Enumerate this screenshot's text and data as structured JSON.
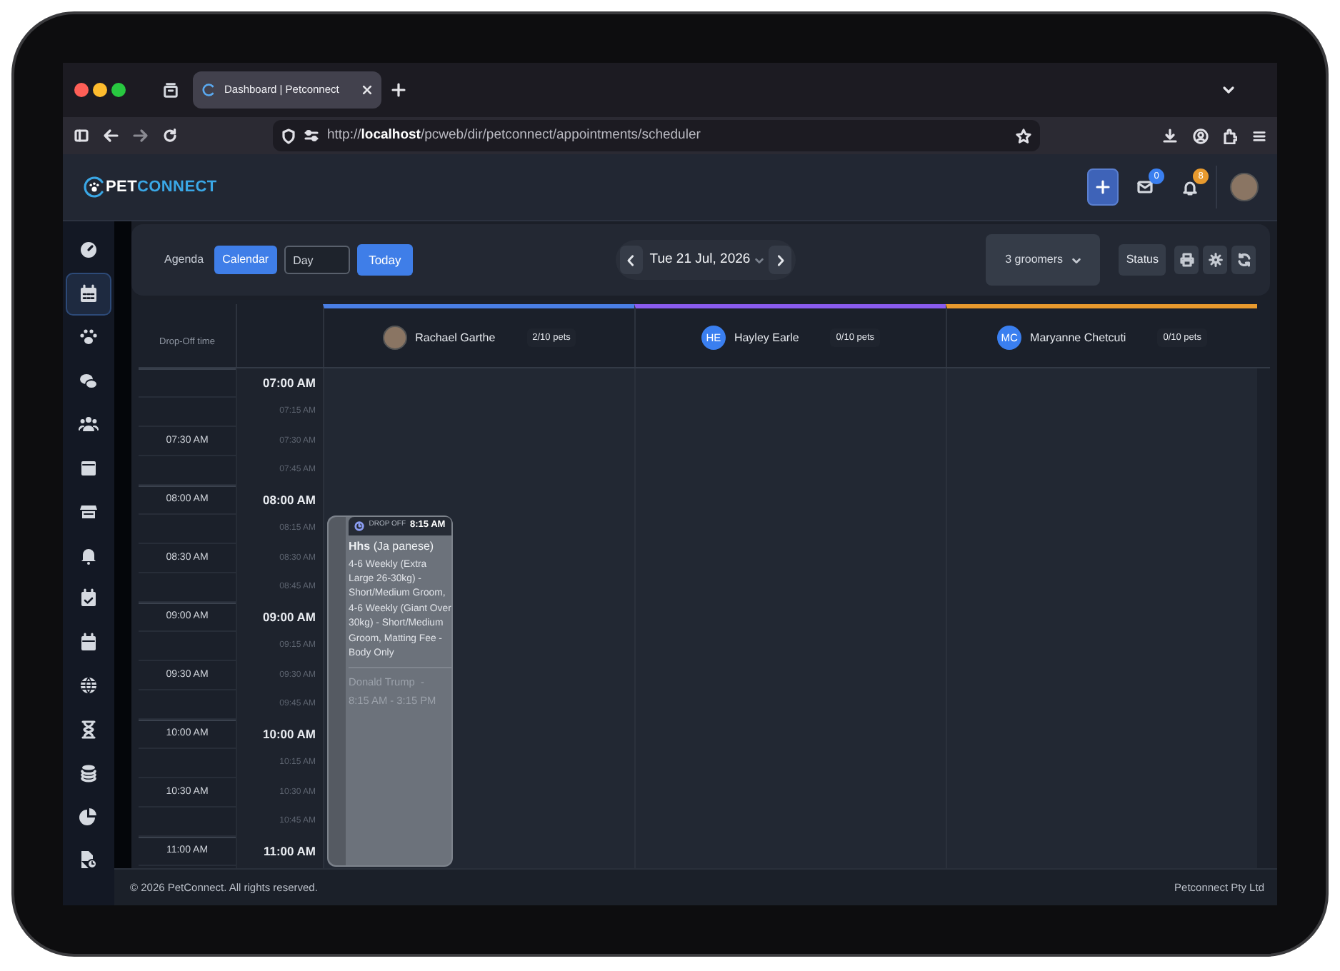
{
  "browser": {
    "tab": {
      "title": "Dashboard | Petconnect",
      "selected": true
    },
    "url": "http://**localhost**/pcweb/dir/petconnect/appointments/scheduler"
  },
  "header": {
    "logo": {
      "part_1": "PET",
      "part_2": "CONNECT"
    },
    "mail_badge": "0",
    "notification_badge": "8"
  },
  "sidebar": {
    "items": [
      {
        "selected": false
      },
      {
        "selected": true
      },
      {
        "selected": false
      },
      {
        "selected": false
      },
      {
        "selected": false
      },
      {
        "selected": false
      },
      {
        "selected": false
      },
      {
        "selected": false
      },
      {
        "selected": false
      },
      {
        "selected": false
      },
      {
        "selected": false
      },
      {
        "selected": false
      },
      {
        "selected": false
      },
      {
        "selected": false
      },
      {
        "selected": false
      }
    ]
  },
  "toolbar": {
    "views": [
      {
        "label": "Agenda",
        "selected": false
      },
      {
        "label": "Calendar",
        "selected": true
      }
    ],
    "range_select": {
      "value": "Day"
    },
    "today_button": "Today",
    "date": "Tue 21 Jul, 2026",
    "groomers_dropdown": "3 groomers",
    "status_button": "Status"
  },
  "scheduler": {
    "dropoff_heading": "Drop-Off time",
    "groomers": [
      {
        "name": "Rachael Garthe",
        "pets": "2/10 pets",
        "color": "#4a7fe6"
      },
      {
        "name": "Hayley Earle",
        "initials": "HE",
        "pets": "0/10 pets",
        "color": "#8a5cf0"
      },
      {
        "name": "Maryanne Chetcuti",
        "initials": "MC",
        "pets": "0/10 pets",
        "color": "#e89a2e"
      }
    ],
    "slots": [
      {
        "time": "07:00 AM",
        "major": true
      },
      {
        "time": "07:15 AM",
        "major": false
      },
      {
        "dropoff": "07:30 AM",
        "time": "07:30 AM",
        "major": false
      },
      {
        "time": "07:45 AM",
        "major": false
      },
      {
        "dropoff": "08:00 AM",
        "time": "08:00 AM",
        "major": true
      },
      {
        "time": "08:15 AM",
        "major": false,
        "appointments": [
          {
            "tag_label": "DROP OFF",
            "tag_time": "8:15 AM",
            "pet": "**Hhs** (Ja panese)",
            "services": "4-6 Weekly (Extra Large 26-30kg) - Short/Medium Groom, 4-6 Weekly (Giant Over 30kg) - Short/Medium Groom, Matting Fee - Body Only",
            "client": "Donald Trump  -",
            "time_range": "8:15 AM - 3:15 PM"
          }
        ]
      },
      {
        "dropoff": "08:30 AM",
        "time": "08:30 AM",
        "major": false
      },
      {
        "time": "08:45 AM",
        "major": false
      },
      {
        "dropoff": "09:00 AM",
        "time": "09:00 AM",
        "major": true
      },
      {
        "time": "09:15 AM",
        "major": false
      },
      {
        "dropoff": "09:30 AM",
        "time": "09:30 AM",
        "major": false
      },
      {
        "time": "09:45 AM",
        "major": false
      },
      {
        "dropoff": "10:00 AM",
        "time": "10:00 AM",
        "major": true
      },
      {
        "time": "10:15 AM",
        "major": false
      },
      {
        "dropoff": "10:30 AM",
        "time": "10:30 AM",
        "major": false
      },
      {
        "time": "10:45 AM",
        "major": false
      },
      {
        "dropoff": "11:00 AM",
        "time": "11:00 AM",
        "major": true
      }
    ]
  },
  "footer": {
    "copyright": "© 2026 PetConnect. All rights reserved.",
    "company": "Petconnect Pty Ltd"
  }
}
